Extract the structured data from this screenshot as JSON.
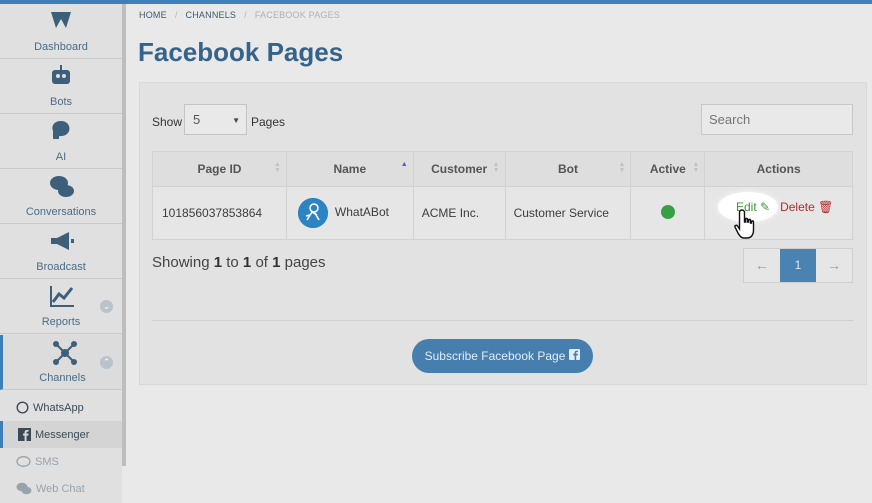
{
  "sidebar": {
    "items": [
      {
        "label": "Dashboard",
        "icon": "dashboard-icon"
      },
      {
        "label": "Bots",
        "icon": "robot-icon"
      },
      {
        "label": "AI",
        "icon": "brain-icon"
      },
      {
        "label": "Conversations",
        "icon": "chat-bubbles-icon"
      },
      {
        "label": "Broadcast",
        "icon": "megaphone-icon"
      },
      {
        "label": "Reports",
        "icon": "line-chart-icon",
        "chevron": "⌄"
      },
      {
        "label": "Channels",
        "icon": "network-icon",
        "chevron": "⌃"
      }
    ],
    "subitems": [
      {
        "label": "WhatsApp",
        "icon": "whatsapp-icon"
      },
      {
        "label": "Messenger",
        "icon": "facebook-icon"
      },
      {
        "label": "SMS",
        "icon": "sms-icon"
      },
      {
        "label": "Web Chat",
        "icon": "webchat-icon"
      }
    ]
  },
  "breadcrumb": {
    "home": "HOME",
    "channels": "CHANNELS",
    "current": "FACEBOOK PAGES"
  },
  "page_title": "Facebook Pages",
  "controls": {
    "show_label": "Show",
    "show_value": "5",
    "pages_label": "Pages",
    "search_placeholder": "Search"
  },
  "table": {
    "headers": [
      "Page ID",
      "Name",
      "Customer",
      "Bot",
      "Active",
      "Actions"
    ],
    "rows": [
      {
        "page_id": "101856037853864",
        "name": "WhatABot",
        "customer": "ACME Inc.",
        "bot": "Customer Service",
        "active": true
      }
    ],
    "edit_label": "Edit",
    "delete_label": "Delete"
  },
  "info": {
    "prefix": "Showing",
    "from": "1",
    "to_word": "to",
    "to": "1",
    "of_word": "of",
    "total": "1",
    "suffix": "pages"
  },
  "pagination": {
    "prev": "←",
    "page": "1",
    "next": "→"
  },
  "subscribe_label": "Subscribe Facebook Page",
  "colors": {
    "accent": "#3d7fb8",
    "title": "#36638a",
    "active": "#38a043",
    "edit": "#3a9a3a",
    "delete": "#b52b2b"
  }
}
